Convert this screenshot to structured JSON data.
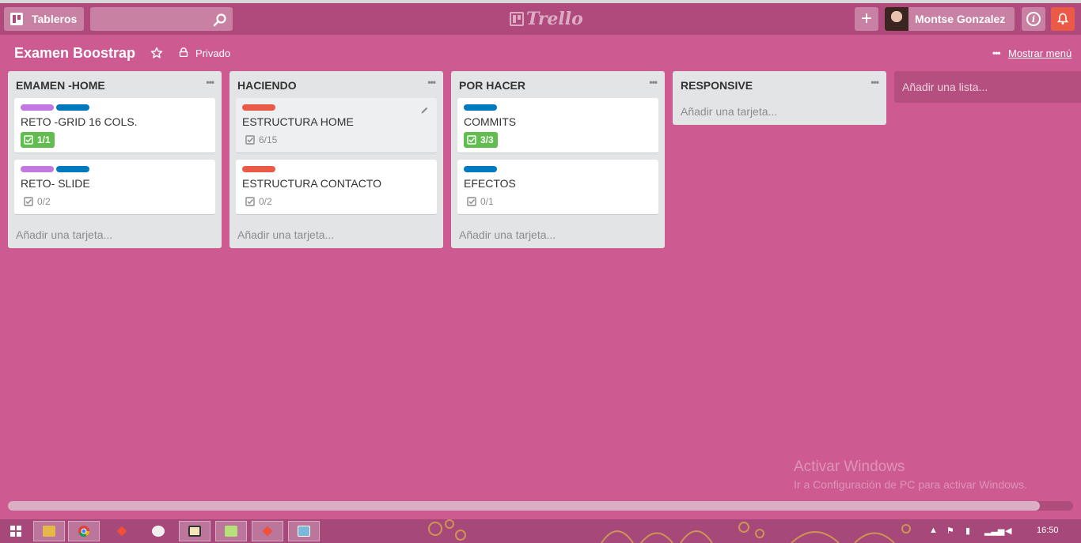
{
  "header": {
    "boards_label": "Tableros",
    "search_placeholder": "",
    "logo_text": "Trello",
    "add_label": "+",
    "user_name": "Montse Gonzalez"
  },
  "board": {
    "title": "Examen Boostrap",
    "visibility": "Privado",
    "menu_label": "Mostrar menú"
  },
  "lists": [
    {
      "title": "EMAMEN -HOME",
      "add_card": "Añadir una tarjeta...",
      "cards": [
        {
          "title": "RETO -GRID 16 COLS.",
          "labels": [
            "#c377e0",
            "#0079bf"
          ],
          "checklist": "1/1",
          "complete": true
        },
        {
          "title": "RETO- SLIDE",
          "labels": [
            "#c377e0",
            "#0079bf"
          ],
          "checklist": "0/2",
          "complete": false
        }
      ]
    },
    {
      "title": "HACIENDO",
      "add_card": "Añadir una tarjeta...",
      "cards": [
        {
          "title": "ESTRUCTURA HOME",
          "labels": [
            "#eb5a46"
          ],
          "checklist": "6/15",
          "complete": false
        },
        {
          "title": "ESTRUCTURA CONTACTO",
          "labels": [
            "#eb5a46"
          ],
          "checklist": "0/2",
          "complete": false
        }
      ]
    },
    {
      "title": "POR HACER",
      "add_card": "Añadir una tarjeta...",
      "cards": [
        {
          "title": "COMMITS",
          "labels": [
            "#0079bf"
          ],
          "checklist": "3/3",
          "complete": true
        },
        {
          "title": "EFECTOS",
          "labels": [
            "#0079bf"
          ],
          "checklist": "0/1",
          "complete": false
        }
      ]
    },
    {
      "title": "RESPONSIVE",
      "add_card": "Añadir una tarjeta...",
      "cards": []
    }
  ],
  "add_list": "Añadir una lista...",
  "watermark": {
    "title": "Activar Windows",
    "subtitle": "Ir a Configuración de PC para activar Windows."
  },
  "taskbar": {
    "time": "16:50"
  },
  "colors": {
    "background": "#cd5a91",
    "header": "#b04a7c",
    "notification": "#eb5a46",
    "complete_badge": "#61bd4f"
  }
}
